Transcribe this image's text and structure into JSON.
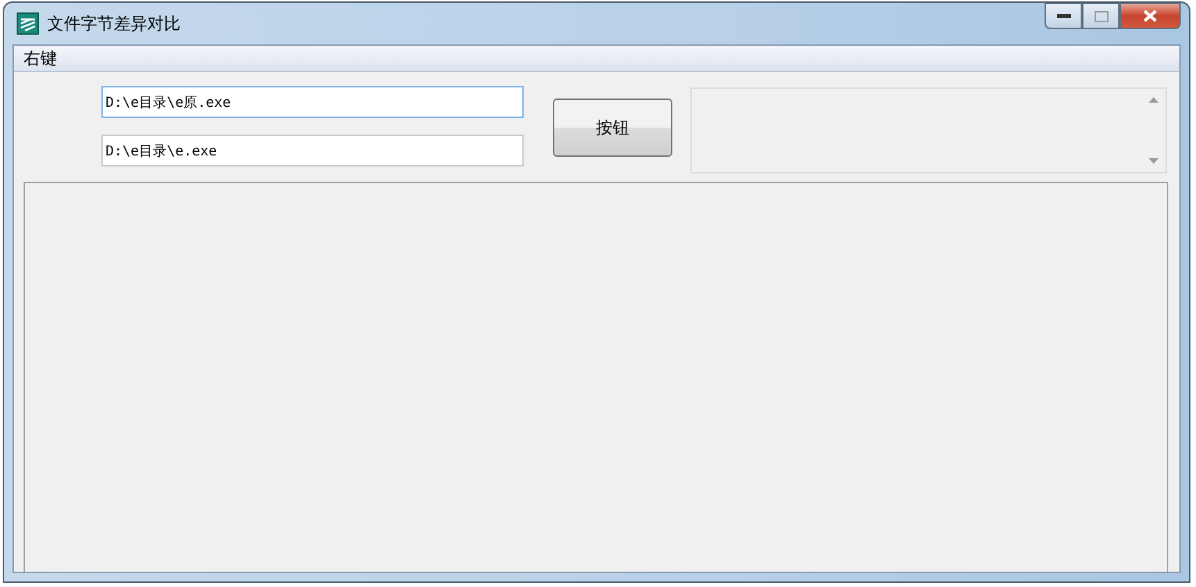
{
  "window": {
    "title": "文件字节差异对比"
  },
  "menu": [
    "右键"
  ],
  "fields": [
    {
      "value": "D:\\e目录\\e原.exe",
      "focused": true
    },
    {
      "value": "D:\\e目录\\e.exe",
      "focused": false
    }
  ],
  "button": {
    "label": "按钮"
  }
}
